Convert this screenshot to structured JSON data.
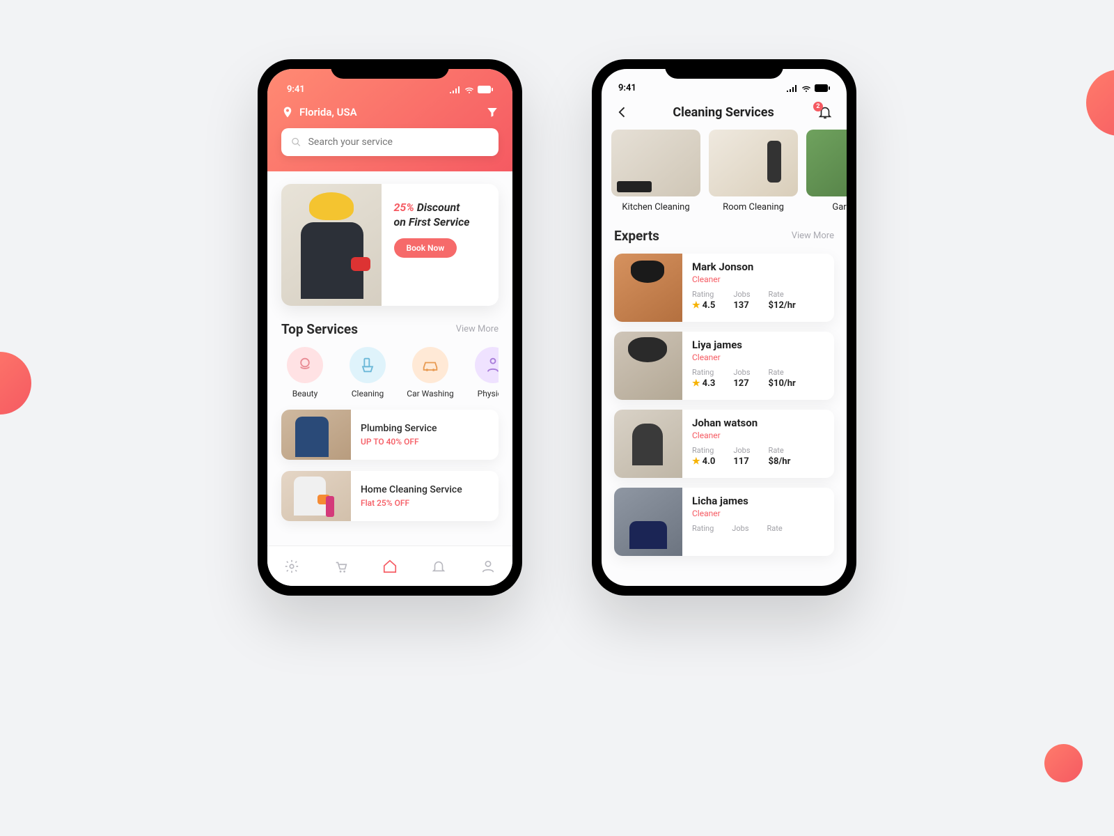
{
  "status_time": "9:41",
  "screen1": {
    "location": "Florida, USA",
    "search_placeholder": "Search your service",
    "promo": {
      "discount": "25%",
      "word_discount": "Discount",
      "line2": "on First Service",
      "cta": "Book Now"
    },
    "top_services_title": "Top Services",
    "view_more": "View More",
    "services": [
      {
        "label": "Beauty"
      },
      {
        "label": "Cleaning"
      },
      {
        "label": "Car Washing"
      },
      {
        "label": "Physical"
      }
    ],
    "offers": [
      {
        "title": "Plumbing Service",
        "sub": "UP TO 40% OFF"
      },
      {
        "title": "Home Cleaning Service",
        "sub": "Flat 25% OFF"
      }
    ]
  },
  "screen2": {
    "title": "Cleaning Services",
    "badge": "2",
    "categories": [
      {
        "label": "Kitchen Cleaning"
      },
      {
        "label": "Room Cleaning"
      },
      {
        "label": "Garden C"
      }
    ],
    "experts_title": "Experts",
    "view_more": "View More",
    "stat_labels": {
      "rating": "Rating",
      "jobs": "Jobs",
      "rate": "Rate"
    },
    "experts": [
      {
        "name": "Mark Jonson",
        "role": "Cleaner",
        "rating": "4.5",
        "jobs": "137",
        "rate": "$12/hr"
      },
      {
        "name": "Liya james",
        "role": "Cleaner",
        "rating": "4.3",
        "jobs": "127",
        "rate": "$10/hr"
      },
      {
        "name": "Johan watson",
        "role": "Cleaner",
        "rating": "4.0",
        "jobs": "117",
        "rate": "$8/hr"
      },
      {
        "name": "Licha james",
        "role": "Cleaner",
        "rating": "",
        "jobs": "",
        "rate": ""
      }
    ]
  }
}
